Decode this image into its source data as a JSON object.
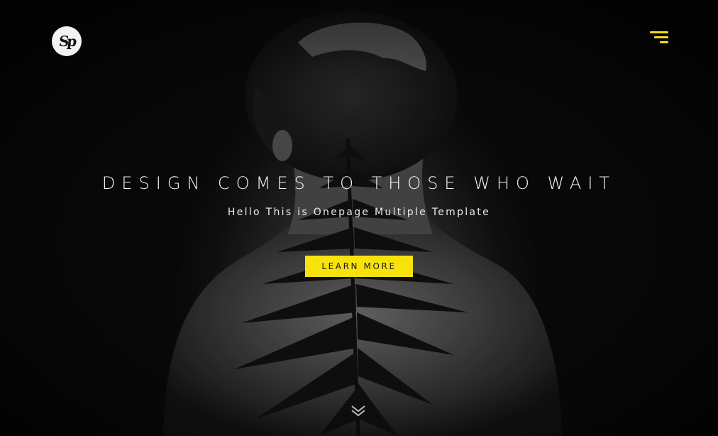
{
  "header": {
    "logo_text": "Sp",
    "menu_icon": "hamburger-menu-icon"
  },
  "hero": {
    "headline": "DESIGN COMES TO THOSE WHO WAIT",
    "subheadline": "Hello This is Onepage Multiple Template",
    "cta_label": "LEARN MORE",
    "scroll_icon": "double-chevron-down-icon"
  },
  "colors": {
    "accent": "#f7e30b",
    "background": "#0a0a0a",
    "text": "#f4f4f4"
  }
}
